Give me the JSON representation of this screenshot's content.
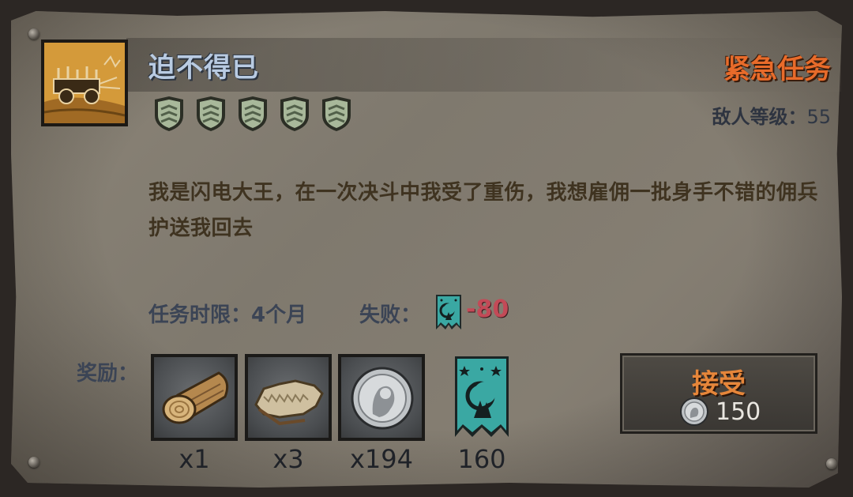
{
  "quest": {
    "title": "迫不得已",
    "type_label": "紧急任务",
    "enemy_level_label": "敌人等级：",
    "enemy_level": "55",
    "difficulty_shields": 5,
    "icon": "caravan-wagon-icon",
    "description": "我是闪电大王，在一次决斗中我受了重伤，我想雇佣一批身手不错的佣兵护送我回去",
    "time_limit_label": "任务时限：",
    "time_limit": "4个月",
    "fail_label": "失败：",
    "fail_value": "-80",
    "fail_icon": "faction-banner-icon"
  },
  "rewards": {
    "label": "奖励：",
    "items": [
      {
        "icon": "wood-log-icon",
        "qty": "x1"
      },
      {
        "icon": "fur-hide-icon",
        "qty": "x3"
      },
      {
        "icon": "silver-coin-icon",
        "qty": "x194"
      },
      {
        "icon": "faction-banner-icon",
        "qty": "160"
      }
    ]
  },
  "accept_button": {
    "label": "接受",
    "cost": "150",
    "cost_icon": "silver-coin-icon"
  },
  "colors": {
    "title": "#b9cbe2",
    "urgent": "#e86b2a",
    "fail_value": "#c34a57",
    "banner_teal": "#3aa8a3",
    "description": "#3f3320"
  }
}
